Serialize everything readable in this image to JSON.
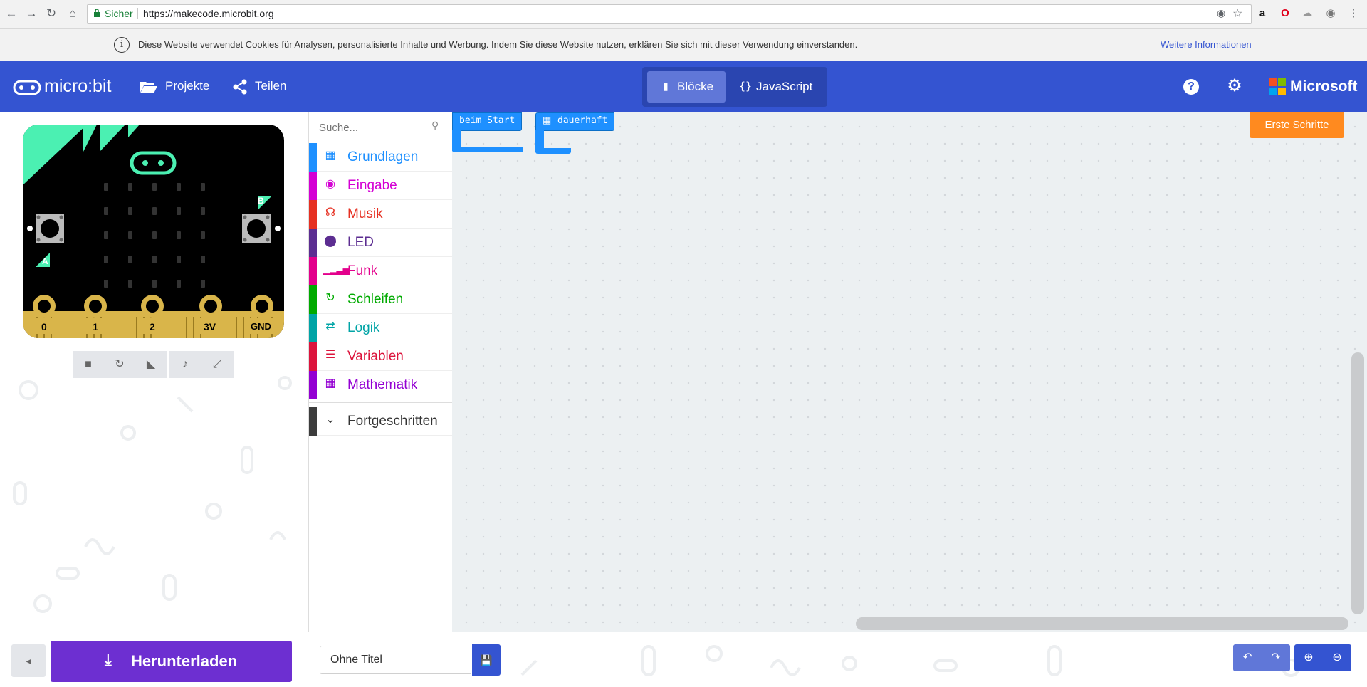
{
  "browser": {
    "secure_label": "Sicher",
    "url": "https://makecode.microbit.org"
  },
  "cookie_banner": {
    "text": "Diese Website verwendet Cookies für Analysen, personalisierte Inhalte und Werbung. Indem Sie diese Website nutzen, erklären Sie sich mit dieser Verwendung einverstanden.",
    "more_link": "Weitere Informationen"
  },
  "header": {
    "logo": "micro:bit",
    "projects": "Projekte",
    "share": "Teilen",
    "blocks_tab": "Blöcke",
    "js_tab": "JavaScript",
    "microsoft": "Microsoft"
  },
  "simulator": {
    "pins": [
      "0",
      "1",
      "2",
      "3V",
      "GND"
    ],
    "button_a": "A",
    "button_b": "B"
  },
  "toolbox": {
    "search_placeholder": "Suche...",
    "categories": [
      {
        "label": "Grundlagen",
        "color": "#1e90ff",
        "icon": "grid-icon"
      },
      {
        "label": "Eingabe",
        "color": "#d400d4",
        "icon": "target-icon"
      },
      {
        "label": "Musik",
        "color": "#e63022",
        "icon": "headphones-icon"
      },
      {
        "label": "LED",
        "color": "#5c2d91",
        "icon": "toggle-icon"
      },
      {
        "label": "Funk",
        "color": "#e3008c",
        "icon": "signal-icon"
      },
      {
        "label": "Schleifen",
        "color": "#00aa00",
        "icon": "loop-icon"
      },
      {
        "label": "Logik",
        "color": "#00a4a6",
        "icon": "shuffle-icon"
      },
      {
        "label": "Variablen",
        "color": "#dc143c",
        "icon": "list-icon"
      },
      {
        "label": "Mathematik",
        "color": "#9400d3",
        "icon": "calculator-icon"
      }
    ],
    "advanced": "Fortgeschritten"
  },
  "workspace": {
    "block_on_start": "beim Start",
    "block_forever": "dauerhaft",
    "getting_started": "Erste Schritte"
  },
  "bottom": {
    "download": "Herunterladen",
    "project_title": "Ohne Titel"
  }
}
